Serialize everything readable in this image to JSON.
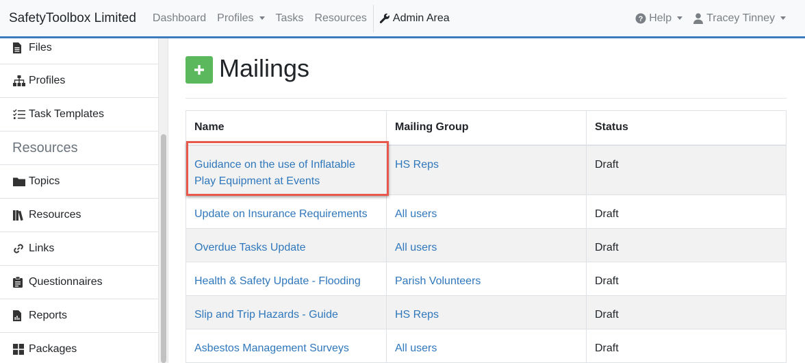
{
  "navbar": {
    "brand": "SafetyToolbox Limited",
    "links": [
      "Dashboard",
      "Profiles",
      "Tasks",
      "Resources"
    ],
    "admin": "Admin Area",
    "help": "Help",
    "user": "Tracey Tinney"
  },
  "sidebar": {
    "items_top": [
      "Files",
      "Profiles",
      "Task Templates"
    ],
    "heading": "Resources",
    "items_bottom": [
      "Topics",
      "Resources",
      "Links",
      "Questionnaires",
      "Reports",
      "Packages"
    ]
  },
  "main": {
    "title": "Mailings",
    "table": {
      "headers": [
        "Name",
        "Mailing Group",
        "Status"
      ],
      "rows": [
        {
          "name": "Guidance on the use of Inflatable Play Equipment at Events",
          "group": "HS Reps",
          "status": "Draft"
        },
        {
          "name": "Update on Insurance Requirements",
          "group": "All users",
          "status": "Draft"
        },
        {
          "name": "Overdue Tasks Update",
          "group": "All users",
          "status": "Draft"
        },
        {
          "name": "Health & Safety Update - Flooding",
          "group": "Parish Volunteers",
          "status": "Draft"
        },
        {
          "name": "Slip and Trip Hazards - Guide",
          "group": "HS Reps",
          "status": "Draft"
        },
        {
          "name": "Asbestos Management Surveys",
          "group": "All users",
          "status": "Draft"
        }
      ]
    }
  },
  "colors": {
    "accent": "#3a7bbf",
    "add_button": "#5cb85c",
    "link": "#2f77bc",
    "highlight": "#e8584c"
  }
}
